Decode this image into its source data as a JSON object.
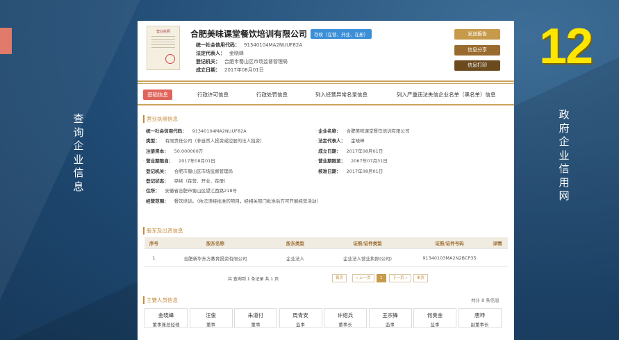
{
  "slide": {
    "left_title": "查询企业信息",
    "right_title": "政府企业信用网",
    "number": "12"
  },
  "company": {
    "license_label": "营业执照",
    "name": "合肥美味课堂餐饮培训有限公司",
    "status": "存续（在营、开业、在册）",
    "credit_code_label": "统一社会信用代码：",
    "credit_code": "91340104MA2NUUF82A",
    "legal_rep_label": "法定代表人：",
    "legal_rep": "金晓峰",
    "reg_authority_label": "登记机关：",
    "reg_authority": "合肥市蜀山区市场监督管理局",
    "founded_label": "成立日期：",
    "founded": "2017年08月01日"
  },
  "actions": {
    "send_report": "发送报告",
    "share": "信息分享",
    "print": "信息打印"
  },
  "tabs": [
    "基础信息",
    "行政许可信息",
    "行政处罚信息",
    "列入经营异常名录信息",
    "列入严重违法失信企业名单（黑名单）信息"
  ],
  "license_section": {
    "title": "营业执照信息",
    "left": [
      {
        "label": "统一社会信用代码：",
        "value": "91340104MA2NUUF82A"
      },
      {
        "label": "类型：",
        "value": "有限责任公司（非自然人投资或控股的法人独资）"
      },
      {
        "label": "注册资本：",
        "value": "50.000000万"
      },
      {
        "label": "营业期限自：",
        "value": "2017年08月01日"
      },
      {
        "label": "登记机关：",
        "value": "合肥市蜀山区市场监督管理局"
      },
      {
        "label": "登记状态：",
        "value": "存续（在营、开业、在册）"
      },
      {
        "label": "住所：",
        "value": "安徽省合肥市蜀山区望江西路218号"
      },
      {
        "label": "经营范围：",
        "value": "餐饮培训。（依法须经批准的项目，经相关部门批准后方可开展经营活动）"
      }
    ],
    "right": [
      {
        "label": "企业名称：",
        "value": "合肥美味课堂餐饮培训有限公司"
      },
      {
        "label": "法定代表人：",
        "value": "金晓峰"
      },
      {
        "label": "成立日期：",
        "value": "2017年08月01日"
      },
      {
        "label": "营业期限至：",
        "value": "2067年07月31日"
      },
      {
        "label": "核准日期：",
        "value": "2017年08月01日"
      }
    ]
  },
  "shareholders": {
    "title": "股东及出资信息",
    "headers": [
      "序号",
      "股东名称",
      "股东类型",
      "证照/证件类型",
      "证照/证件号码",
      "详情"
    ],
    "rows": [
      [
        "1",
        "合肥新华东方教育投资有限公司",
        "企业法人",
        "企业法人营业执照(公司)",
        "91340103MA2N2BCP35",
        ""
      ]
    ],
    "pager_text": "共 查询到 1 条记录 共 1 页",
    "pager": {
      "first": "首页",
      "prev": "« 上一页",
      "page": "1",
      "next": "下一页 »",
      "last": "末页"
    }
  },
  "personnel": {
    "title": "主要人员信息",
    "count": "共计 8 条信息",
    "people": [
      {
        "name": "金晓峰",
        "role": "董事兼总经理"
      },
      {
        "name": "汪俊",
        "role": "董事"
      },
      {
        "name": "朱道付",
        "role": "董事"
      },
      {
        "name": "周青安",
        "role": "监事"
      },
      {
        "name": "许绍兵",
        "role": "董事长"
      },
      {
        "name": "王宗锋",
        "role": "监事"
      },
      {
        "name": "何贵金",
        "role": "监事"
      },
      {
        "name": "唐坤",
        "role": "副董事长"
      }
    ]
  }
}
